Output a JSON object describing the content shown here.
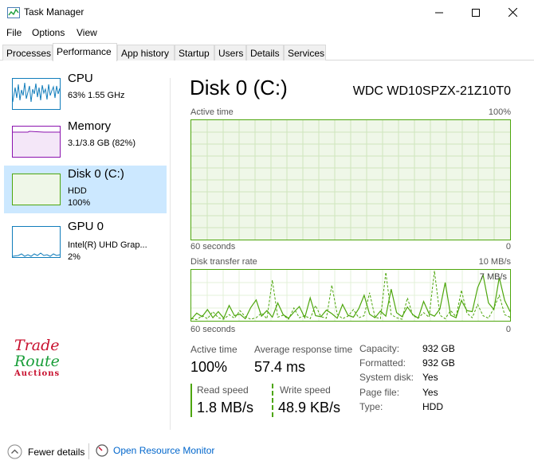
{
  "window": {
    "title": "Task Manager",
    "minimize_icon": "minimize-icon",
    "maximize_icon": "maximize-icon",
    "close_icon": "close-icon"
  },
  "menu": [
    "File",
    "Options",
    "View"
  ],
  "tabs": [
    {
      "label": "Processes",
      "active": false
    },
    {
      "label": "Performance",
      "active": true
    },
    {
      "label": "App history",
      "active": false
    },
    {
      "label": "Startup",
      "active": false
    },
    {
      "label": "Users",
      "active": false
    },
    {
      "label": "Details",
      "active": false
    },
    {
      "label": "Services",
      "active": false
    }
  ],
  "sidebar": {
    "items": [
      {
        "title": "CPU",
        "line1": "63%  1.55 GHz",
        "line2": "",
        "selected": false,
        "color": "#117dbb"
      },
      {
        "title": "Memory",
        "line1": "3.1/3.8 GB (82%)",
        "line2": "",
        "selected": false,
        "color": "#8b12ae"
      },
      {
        "title": "Disk 0 (C:)",
        "line1": "HDD",
        "line2": "100%",
        "selected": true,
        "color": "#4da60c"
      },
      {
        "title": "GPU 0",
        "line1": "Intel(R) UHD Grap...",
        "line2": "2%",
        "selected": false,
        "color": "#117dbb"
      }
    ]
  },
  "logo": {
    "line1": "Trade",
    "line2": "Route",
    "line3": "Auctions"
  },
  "main": {
    "title": "Disk 0 (C:)",
    "model": "WDC WD10SPZX-21Z10T0",
    "active_graph": {
      "label": "Active time",
      "max_label": "100%",
      "time_label": "60 seconds",
      "min_label": "0",
      "value_percent": 100
    },
    "transfer_graph": {
      "label": "Disk transfer rate",
      "max_label": "10 MB/s",
      "mid_label": "7 MB/s",
      "time_label": "60 seconds",
      "min_label": "0"
    },
    "stats": {
      "active_time_label": "Active time",
      "active_time_value": "100%",
      "avg_response_label": "Average response time",
      "avg_response_value": "57.4 ms",
      "read_label": "Read speed",
      "read_value": "1.8 MB/s",
      "write_label": "Write speed",
      "write_value": "48.9 KB/s"
    },
    "details": [
      {
        "key": "Capacity:",
        "value": "932 GB"
      },
      {
        "key": "Formatted:",
        "value": "932 GB"
      },
      {
        "key": "System disk:",
        "value": "Yes"
      },
      {
        "key": "Page file:",
        "value": "Yes"
      },
      {
        "key": "Type:",
        "value": "HDD"
      }
    ]
  },
  "footer": {
    "fewer_details": "Fewer details",
    "open_monitor": "Open Resource Monitor"
  },
  "colors": {
    "disk_green": "#4da60c",
    "selected_bg": "#cce8ff",
    "link": "#0066cc"
  },
  "chart_data": {
    "type": "line",
    "title": "Disk transfer rate",
    "xlabel": "60 seconds",
    "ylabel": "",
    "ylim": [
      0,
      10
    ],
    "y_unit": "MB/s",
    "series": [
      {
        "name": "Read speed",
        "style": "solid",
        "values": [
          0.3,
          1.5,
          0.8,
          2.2,
          0.6,
          1.8,
          0.5,
          3.0,
          1.0,
          1.3,
          0.4,
          2.6,
          4.1,
          0.9,
          2.0,
          0.7,
          3.5,
          1.2,
          0.5,
          1.7,
          2.8,
          0.6,
          4.5,
          1.0,
          0.8,
          2.1,
          1.4,
          0.5,
          3.2,
          1.1,
          0.7,
          2.4,
          5.0,
          1.3,
          0.6,
          1.9,
          0.9,
          6.2,
          1.6,
          0.8,
          2.7,
          1.2,
          0.5,
          3.8,
          1.4,
          0.9,
          2.3,
          7.5,
          1.1,
          0.6,
          4.0,
          2.0,
          1.8,
          6.5,
          9.0,
          3.5,
          2.2,
          8.5,
          4.0,
          1.8
        ]
      },
      {
        "name": "Write speed",
        "style": "dashed",
        "values": [
          0.5,
          0.2,
          1.0,
          0.4,
          1.8,
          0.6,
          0.3,
          1.2,
          0.5,
          2.0,
          0.8,
          0.3,
          0.6,
          1.5,
          0.4,
          8.0,
          0.7,
          1.1,
          0.3,
          2.5,
          0.6,
          1.0,
          0.4,
          3.0,
          0.8,
          0.5,
          7.0,
          1.3,
          0.4,
          0.9,
          2.2,
          0.6,
          1.0,
          5.5,
          0.7,
          0.4,
          9.5,
          1.2,
          0.6,
          0.3,
          4.5,
          1.0,
          0.5,
          1.6,
          0.7,
          9.8,
          1.1,
          0.4,
          2.0,
          0.8,
          6.0,
          1.5,
          0.6,
          3.2,
          1.0,
          0.5,
          2.5,
          5.0,
          1.2,
          0.7
        ]
      }
    ]
  }
}
